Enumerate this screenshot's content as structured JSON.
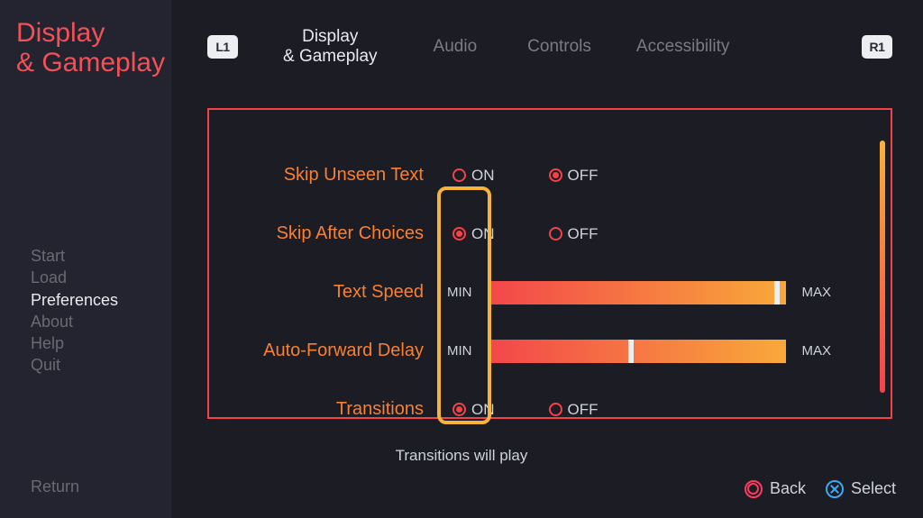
{
  "title_line1": "Display",
  "title_line2": "& Gameplay",
  "side_menu": {
    "items": [
      "Start",
      "Load",
      "Preferences",
      "About",
      "Help",
      "Quit"
    ],
    "selected_index": 2,
    "return_label": "Return"
  },
  "bumpers": {
    "left": "L1",
    "right": "R1"
  },
  "tabs": {
    "items": [
      "Display\n& Gameplay",
      "Audio",
      "Controls",
      "Accessibility"
    ],
    "active_index": 0
  },
  "settings": {
    "skip_unseen": {
      "label": "Skip Unseen Text",
      "on": "ON",
      "off": "OFF",
      "value": "OFF"
    },
    "skip_after": {
      "label": "Skip After Choices",
      "on": "ON",
      "off": "OFF",
      "value": "ON"
    },
    "text_speed": {
      "label": "Text Speed",
      "min": "MIN",
      "max": "MAX",
      "value_pct": 97
    },
    "auto_forward": {
      "label": "Auto-Forward Delay",
      "min": "MIN",
      "max": "MAX",
      "value_pct": 48
    },
    "transitions": {
      "label": "Transitions",
      "on": "ON",
      "off": "OFF",
      "value": "ON"
    }
  },
  "hint_text": "Transitions will play",
  "footer": {
    "back": "Back",
    "select": "Select"
  }
}
